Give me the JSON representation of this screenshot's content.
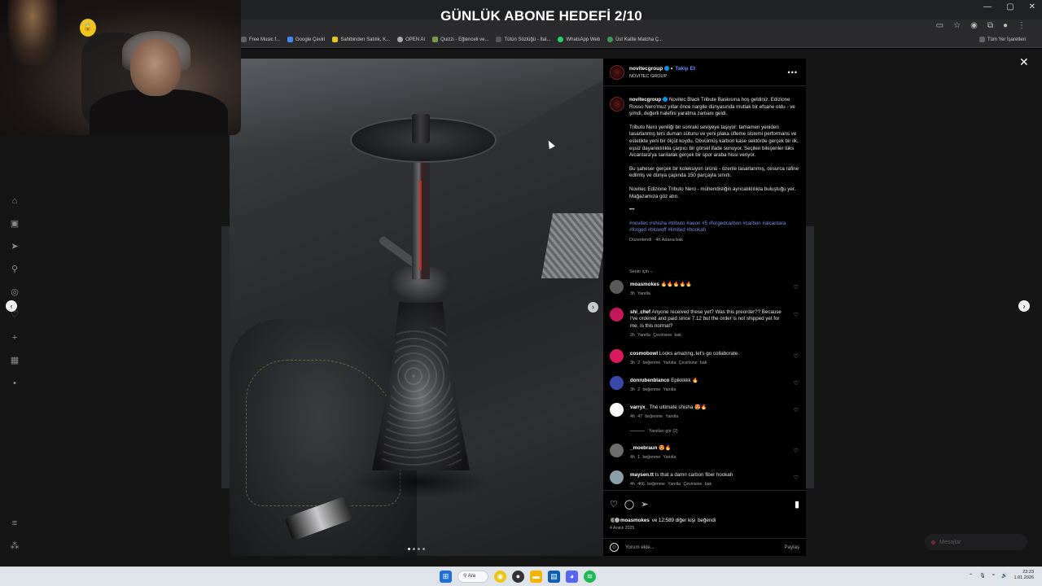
{
  "browser": {
    "bookmarks": [
      {
        "label": "Free Music f...",
        "icon": "music-icon"
      },
      {
        "label": "Google Çeviri",
        "icon": "translate-icon"
      },
      {
        "label": "Sahibinden Satılık, K...",
        "icon": "sahibinden-icon"
      },
      {
        "label": "OPEN AI",
        "icon": "openai-icon"
      },
      {
        "label": "Quizzi - Eğlenceli ve...",
        "icon": "quiz-icon"
      },
      {
        "label": "Tütün Sözlüğü - İtal...",
        "icon": "dictionary-icon"
      },
      {
        "label": "WhatsApp Web",
        "icon": "whatsapp-icon"
      },
      {
        "label": "Üst Kalite Matcha Ç...",
        "icon": "matcha-icon"
      }
    ],
    "all_bookmarks_label": "Tüm Yer İşaretleri"
  },
  "overlay": {
    "title": "GÜNLÜK ABONE HEDEFİ 2/10"
  },
  "post": {
    "username": "novitecgroup",
    "follow_label": "Takip Et",
    "subtitle": "NOVITEC GROUP",
    "caption_intro": "Novitec Black Tribute Baskısına hoş geldiniz. Edizione Rosso Nero'muz yıllar önce nargile dünyasında mutlak bir efsane oldu - ve şimdi, değerli halefini yaratma zamanı geldi.",
    "caption_p2": "Tributo Nero yeniliği bir sonraki seviyeye taşıyor: tamamen yeniden tasarlanmış ters duman sütunu ve yeni plaka üfleme sistemi performans ve estetikte yeni bir ölçüt koydu. Dövülmüş karbon kase sektörde gerçek bir ilk, eşsiz dayanıklılıkla çarpıcı bir görsel ifade sunuyor. Seçilen bileşenler lüks Alcantara'ya sarılarak gerçek bir spor araba hissi veriyor.",
    "caption_p3": "Bu şaheser gerçek bir koleksiyon ürünü - özenle tasarlanmış, cesurca rafine edilmiş ve dünya çapında 150 parçayla sınırlı.",
    "caption_p4": "Novitec Edizione Tributo Nero - mühendisliğin ayrıcalıklılıkla buluştuğu yer. Mağazamıza göz atın.",
    "caption_ellipsis": "•••",
    "hashtags": "#novitec #shisha #tributo #aeon #5 #forgedcarbon #carbon #alcantara #forged #blowoff #limited #hookah",
    "edited_meta": "Düzenlendi · 4h     Adana bak",
    "for_you": "Senin için ⌵",
    "comments": [
      {
        "user": "moasmokes",
        "text": "🔥🔥🔥🔥🔥",
        "meta": "3h  Yanıtla"
      },
      {
        "user": "shi_chef",
        "text": "Anyone received these yet? Was this preorder?? Because I've ordered and paid since 7.12 but the order is not shipped yet for me. Is this normal?",
        "meta": "2h  Yanıtla  Çevirisine bak"
      },
      {
        "user": "cosmobowl",
        "text": "Looks amazing, let's go collaborate.",
        "meta": "3h  2 beğenme  Yanıtla  Çevirisine bak"
      },
      {
        "user": "donrubenblanco",
        "text": "Epikkkkk 🔥",
        "meta": "3h  2 beğenme  Yanıtla"
      },
      {
        "user": "varryx_",
        "text": "The ultimate shisha 😍🔥",
        "meta": "4h  47 beğenme  Yanıtla"
      },
      {
        "user": "_moebraun",
        "text": "😍🔥",
        "meta": "4h  1 beğenme  Yanıtla"
      },
      {
        "user": "maysen.tt",
        "text": "Is that a damn carbon fiber hookah",
        "meta": "4h  466 beğenme  Yanıtla  Çevirisine bak"
      }
    ],
    "view_replies": "Yanıtları gör (2)",
    "likes_user": "moasmokes",
    "likes_rest": "ve 12.589 diğer kişi",
    "likes_suffix": "beğendi",
    "date": "4 Aralık 2025",
    "comment_placeholder": "Yorum ekle...",
    "post_button": "Paylaş"
  },
  "messages_label": "Mesajlar",
  "taskbar": {
    "search_label": "Ara",
    "time": "23:23",
    "date": "1.01.2026"
  },
  "colors": {
    "accent_link": "#7b8fe8",
    "verified": "#0095f6",
    "overlay_text": "#ffffff"
  }
}
